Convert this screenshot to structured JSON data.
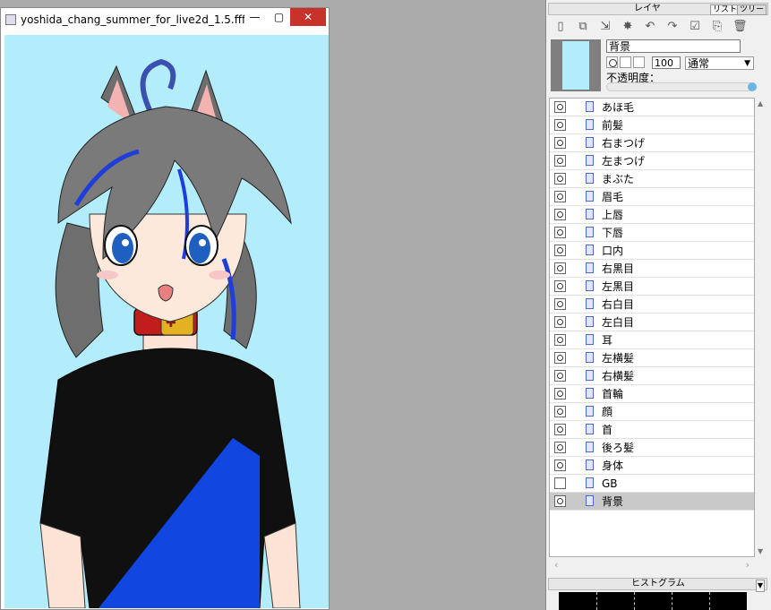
{
  "image_window": {
    "title": "yoshida_chang_summer_for_live2d_1.5.fff (...",
    "minimize_symbol": "—",
    "maximize_symbol": "▢",
    "close_symbol": "✕",
    "canvas_bg": "#b3ecfb"
  },
  "layer_panel": {
    "caption": "レイヤ",
    "tab_list": "リスト",
    "tab_tree": "ツリー",
    "toolbar": [
      {
        "name": "new-layer-icon",
        "glyph": "▯"
      },
      {
        "name": "duplicate-layer-icon",
        "glyph": "⧉"
      },
      {
        "name": "merge-down-icon",
        "glyph": "⇲"
      },
      {
        "name": "new-folder-icon",
        "glyph": "✸"
      },
      {
        "name": "undo-icon",
        "glyph": "↶"
      },
      {
        "name": "redo-icon",
        "glyph": "↷"
      },
      {
        "name": "layer-properties-icon",
        "glyph": "☑"
      },
      {
        "name": "copy-layer-icon",
        "glyph": "⎘"
      },
      {
        "name": "delete-layer-icon",
        "glyph": "🗑"
      }
    ],
    "current_layer_name": "背景",
    "opacity_value": "100",
    "blend_mode": "通常",
    "opacity_label": "不透明度：",
    "opacity_level": 1.0,
    "layers": [
      {
        "name": "あほ毛",
        "visible": true
      },
      {
        "name": "前髪",
        "visible": true
      },
      {
        "name": "右まつげ",
        "visible": true
      },
      {
        "name": "左まつげ",
        "visible": true
      },
      {
        "name": "まぶた",
        "visible": true
      },
      {
        "name": "眉毛",
        "visible": true
      },
      {
        "name": "上唇",
        "visible": true
      },
      {
        "name": "下唇",
        "visible": true
      },
      {
        "name": "口内",
        "visible": true
      },
      {
        "name": "右黒目",
        "visible": true
      },
      {
        "name": "左黒目",
        "visible": true
      },
      {
        "name": "右白目",
        "visible": true
      },
      {
        "name": "左白目",
        "visible": true
      },
      {
        "name": "耳",
        "visible": true
      },
      {
        "name": "左横髪",
        "visible": true
      },
      {
        "name": "右横髪",
        "visible": true
      },
      {
        "name": "首輪",
        "visible": true
      },
      {
        "name": "顔",
        "visible": true
      },
      {
        "name": "首",
        "visible": true
      },
      {
        "name": "後ろ髪",
        "visible": true
      },
      {
        "name": "身体",
        "visible": true
      },
      {
        "name": "GB",
        "visible": false
      },
      {
        "name": "背景",
        "visible": true,
        "selected": true
      }
    ],
    "histogram_caption": "ヒストグラム"
  },
  "colors": {
    "panel_bg": "#f0f0f0",
    "selected_row": "#c9c9c9",
    "close_red": "#c7322a",
    "sky_blue": "#b3ecfb"
  }
}
